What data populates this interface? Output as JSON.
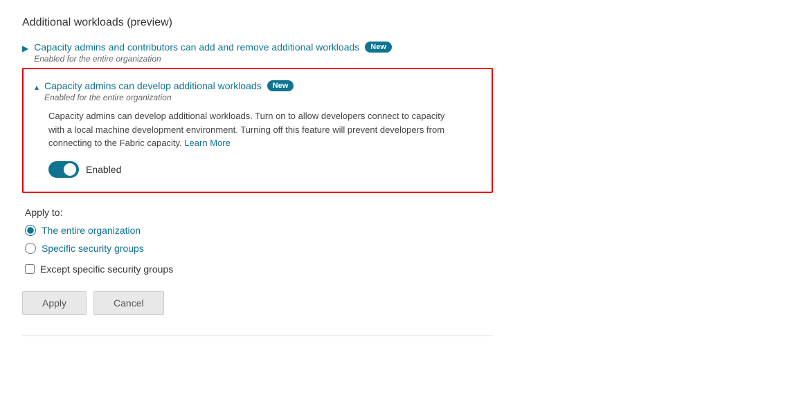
{
  "page": {
    "title": "Additional workloads (preview)"
  },
  "collapsed_item": {
    "chevron": "▶",
    "title": "Capacity admins and contributors can add and remove additional workloads",
    "badge": "New",
    "subtitle": "Enabled for the entire organization"
  },
  "expanded_item": {
    "chevron": "▴",
    "title": "Capacity admins can develop additional workloads",
    "badge": "New",
    "subtitle": "Enabled for the entire organization",
    "description_part1": "Capacity admins can develop additional workloads. Turn on to allow developers connect to capacity with a local machine development environment. Turning off this feature will prevent developers from connecting to the Fabric capacity.",
    "learn_more": "Learn More",
    "toggle_label": "Enabled"
  },
  "apply_to": {
    "label": "Apply to:",
    "options": [
      {
        "id": "entire-org",
        "label": "The entire organization",
        "checked": true
      },
      {
        "id": "specific-groups",
        "label": "Specific security groups",
        "checked": false
      }
    ],
    "except_label": "Except specific security groups"
  },
  "buttons": {
    "apply": "Apply",
    "cancel": "Cancel"
  }
}
